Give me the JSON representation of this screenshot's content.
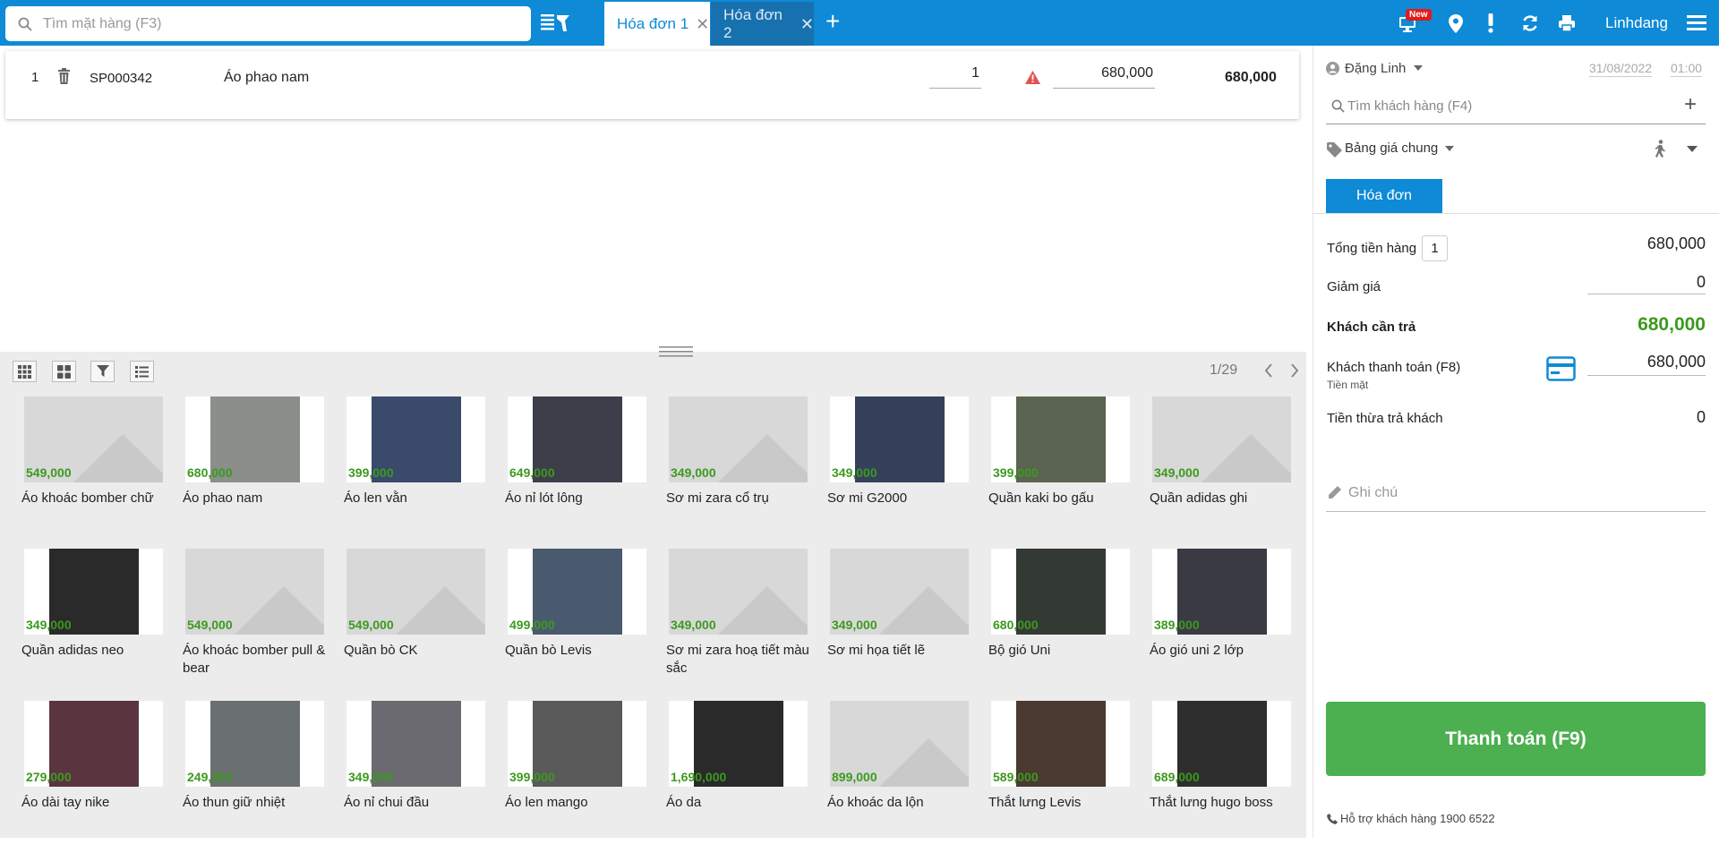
{
  "topbar": {
    "search_placeholder": "Tìm mặt hàng (F3)",
    "tabs": [
      {
        "label": "Hóa đơn 1"
      },
      {
        "label": "Hóa đơn 2"
      }
    ],
    "new_badge": "New",
    "username": "Linhdang",
    "icons": [
      "barcode-scan-icon",
      "monitor-icon",
      "location-icon",
      "alert-icon",
      "refresh-icon",
      "print-icon",
      "menu-icon"
    ]
  },
  "cart": {
    "items": [
      {
        "index": "1",
        "code": "SP000342",
        "name": "Áo phao nam",
        "qty": "1",
        "price": "680,000",
        "total": "680,000"
      }
    ]
  },
  "products": {
    "pager": "1/29",
    "items": [
      {
        "price": "549,000",
        "name": "Áo khoác bomber chữ"
      },
      {
        "price": "680,000",
        "name": "Áo phao nam"
      },
      {
        "price": "399,000",
        "name": "Áo len vằn"
      },
      {
        "price": "649,000",
        "name": "Áo nỉ lót lông"
      },
      {
        "price": "349,000",
        "name": "Sơ mi zara cổ trụ"
      },
      {
        "price": "349,000",
        "name": "Sơ mi G2000"
      },
      {
        "price": "399,000",
        "name": "Quần kaki bo gấu"
      },
      {
        "price": "349,000",
        "name": "Quần adidas ghi"
      },
      {
        "price": "349,000",
        "name": "Quần adidas neo"
      },
      {
        "price": "549,000",
        "name": "Áo khoác bomber pull & bear"
      },
      {
        "price": "549,000",
        "name": "Quần bò CK"
      },
      {
        "price": "499,000",
        "name": "Quần bò Levis"
      },
      {
        "price": "349,000",
        "name": "Sơ mi zara hoạ tiết màu sắc"
      },
      {
        "price": "349,000",
        "name": "Sơ mi họa tiết lẽ"
      },
      {
        "price": "680,000",
        "name": "Bộ gió Uni"
      },
      {
        "price": "389,000",
        "name": "Áo gió uni 2 lớp"
      },
      {
        "price": "279,000",
        "name": "Áo dài tay nike"
      },
      {
        "price": "249,000",
        "name": "Áo thun giữ nhiệt"
      },
      {
        "price": "349,000",
        "name": "Áo nỉ chui đầu"
      },
      {
        "price": "399,000",
        "name": "Áo len mango"
      },
      {
        "price": "1,690,000",
        "name": "Áo da"
      },
      {
        "price": "899,000",
        "name": "Áo khoác da lộn"
      },
      {
        "price": "589,000",
        "name": "Thắt lưng Levis"
      },
      {
        "price": "689,000",
        "name": "Thắt lưng hugo boss"
      }
    ]
  },
  "invoice": {
    "seller": "Đặng Linh",
    "date": "31/08/2022",
    "time": "01:00",
    "customer_placeholder": "Tìm khách hàng (F4)",
    "price_list": "Bảng giá chung",
    "tab_label": "Hóa đơn",
    "total_goods_label": "Tổng tiền hàng",
    "total_goods_count": "1",
    "total_goods_value": "680,000",
    "discount_label": "Giảm giá",
    "discount_value": "0",
    "customer_pay_label": "Khách cần trả",
    "customer_pay_value": "680,000",
    "customer_paid_label": "Khách thanh toán (F8)",
    "payment_method": "Tiền mặt",
    "customer_paid_value": "680,000",
    "change_label": "Tiền thừa trả khách",
    "change_value": "0",
    "note_placeholder": "Ghi chú",
    "pay_button": "Thanh toán (F9)",
    "support": "Hỗ trợ khách hàng 1900 6522"
  },
  "colors": {
    "primary": "#0e8ad6",
    "green": "#4caf50",
    "price_green": "#3b9a1d"
  }
}
